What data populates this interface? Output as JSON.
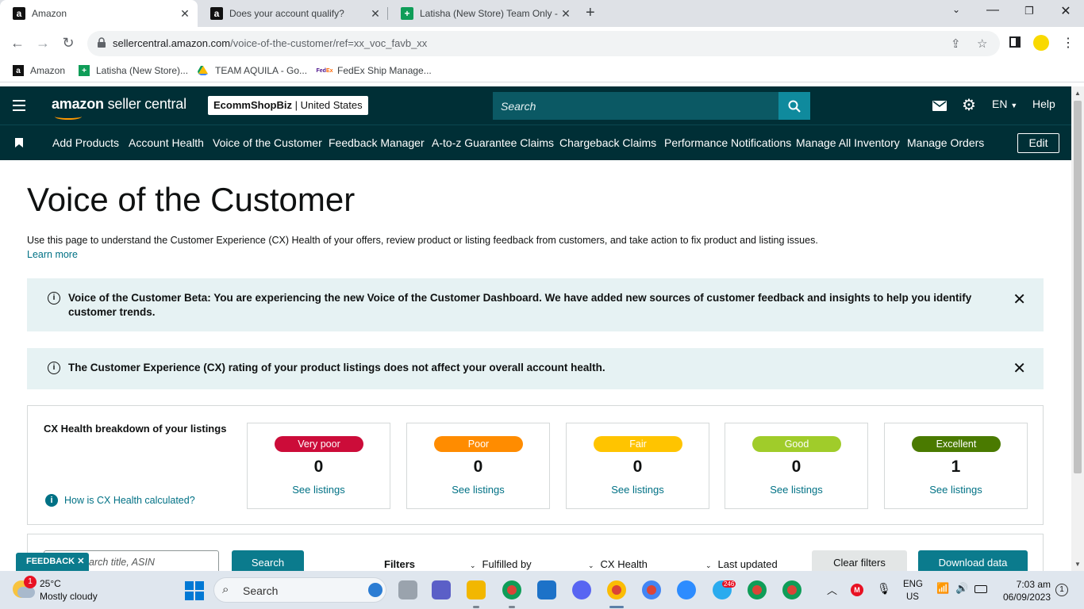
{
  "browser": {
    "tabs": [
      {
        "title": "Amazon",
        "icon": "amazon-favicon"
      },
      {
        "title": "Does your account qualify?",
        "icon": "amazon-favicon"
      },
      {
        "title": "Latisha (New Store) Team Only - ",
        "icon": "sheets-favicon"
      }
    ],
    "url_domain": "sellercentral.amazon.com",
    "url_path": "/voice-of-the-customer/ref=xx_voc_favb_xx",
    "bookmarks": [
      {
        "label": "Amazon",
        "icon": "amazon-favicon"
      },
      {
        "label": "Latisha (New Store)...",
        "icon": "sheets-favicon"
      },
      {
        "label": "TEAM AQUILA - Go...",
        "icon": "drive-favicon"
      },
      {
        "label": "FedEx Ship Manage...",
        "icon": "fedex-favicon"
      }
    ]
  },
  "header": {
    "logo_bold": "amazon",
    "logo_light": " seller central",
    "store_name": "EcommShopBiz",
    "store_region": " | United States",
    "search_placeholder": "Search",
    "language": "EN",
    "help": "Help"
  },
  "nav": {
    "items": [
      "Add Products",
      "Account Health",
      "Voice of the Customer",
      "Feedback Manager",
      "A-to-z Guarantee Claims",
      "Chargeback Claims",
      "Performance Notifications",
      "Manage All Inventory",
      "Manage Orders"
    ],
    "edit": "Edit"
  },
  "page": {
    "title": "Voice of the Customer",
    "intro": "Use this page to understand the Customer Experience (CX) Health of your offers, review product or listing feedback from customers, and take action to fix product and listing issues.",
    "learn_more": "Learn more",
    "banner1_line1": "Voice of the Customer Beta: You are experiencing the new Voice of the Customer Dashboard. We have added new sources of customer feedback and insights to help you identify",
    "banner1_line2": "customer trends.",
    "banner2": "The Customer Experience (CX) rating of your product listings does not affect your overall account health."
  },
  "cx_health": {
    "title": "CX Health breakdown of your listings",
    "how_link": "How is CX Health calculated?",
    "categories": [
      {
        "label": "Very poor",
        "count": "0",
        "link": "See listings",
        "color": "#cc0c39"
      },
      {
        "label": "Poor",
        "count": "0",
        "link": "See listings",
        "color": "#ff8c00"
      },
      {
        "label": "Fair",
        "count": "0",
        "link": "See listings",
        "color": "#ffc400"
      },
      {
        "label": "Good",
        "count": "0",
        "link": "See listings",
        "color": "#a0cc2a"
      },
      {
        "label": "Excellent",
        "count": "1",
        "link": "See listings",
        "color": "#4a7a00"
      }
    ]
  },
  "filters": {
    "search_placeholder": "arch title, ASIN",
    "search_button": "Search",
    "filters_label": "Filters",
    "fulfilled_by": "Fulfilled by",
    "cx_health": "CX Health",
    "last_updated": "Last updated",
    "clear": "Clear filters",
    "download": "Download data",
    "feedback": "FEEDBACK"
  },
  "taskbar": {
    "weather_badge": "1",
    "temperature": "25°C",
    "condition": "Mostly cloudy",
    "search": "Search",
    "lang_top": "ENG",
    "lang_bottom": "US",
    "time": "7:03 am",
    "date": "06/09/2023",
    "notifications": "1",
    "telegram_badge": "246"
  }
}
